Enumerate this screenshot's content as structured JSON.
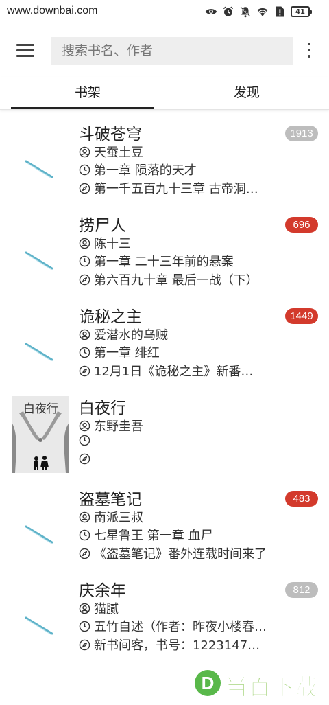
{
  "status_bar": {
    "watermark": "www.downbai.com",
    "battery": "41",
    "icons": [
      "eye-icon",
      "alarm-icon",
      "mute-icon",
      "wifi-icon",
      "sim-alert-icon",
      "battery-icon"
    ]
  },
  "app_bar": {
    "menu_icon": "menu-icon",
    "search_placeholder": "搜索书名、作者",
    "more_icon": "more-vertical-icon"
  },
  "tabs": [
    {
      "label": "书架",
      "active": true
    },
    {
      "label": "发现",
      "active": false
    }
  ],
  "books": [
    {
      "title": "斗破苍穹",
      "author": "天蚕土豆",
      "progress": "第一章 陨落的天才",
      "latest": "第一千五百九十三章 古帝洞…",
      "badge": "1913",
      "badge_color": "#bdbdbd",
      "cover": "placeholder"
    },
    {
      "title": "捞尸人",
      "author": "陈十三",
      "progress": "第一章 二十三年前的悬案",
      "latest": "第六百九十章 最后一战（下）",
      "badge": "696",
      "badge_color": "#d33a2c",
      "cover": "placeholder"
    },
    {
      "title": "诡秘之主",
      "author": "爱潜水的乌贼",
      "progress": "第一章 绯红",
      "latest": "12月1日《诡秘之主》新番…",
      "badge": "1449",
      "badge_color": "#d33a2c",
      "cover": "placeholder"
    },
    {
      "title": "白夜行",
      "author": "东野圭吾",
      "progress": "",
      "latest": "",
      "badge": "",
      "badge_color": "",
      "cover": "image",
      "cover_title": "白夜行"
    },
    {
      "title": "盗墓笔记",
      "author": "南派三叔",
      "progress": "七星鲁王 第一章 血尸",
      "latest": "《盗墓笔记》番外连载时间来了",
      "badge": "483",
      "badge_color": "#d33a2c",
      "cover": "placeholder"
    },
    {
      "title": "庆余年",
      "author": "猫腻",
      "progress": "五竹自述（作者：昨夜小楼春…",
      "latest": "新书间客，书号：1223147…",
      "badge": "812",
      "badge_color": "#bdbdbd",
      "cover": "placeholder"
    }
  ],
  "watermark_bottom": {
    "logo_letter": "D",
    "text": "当百下载"
  }
}
